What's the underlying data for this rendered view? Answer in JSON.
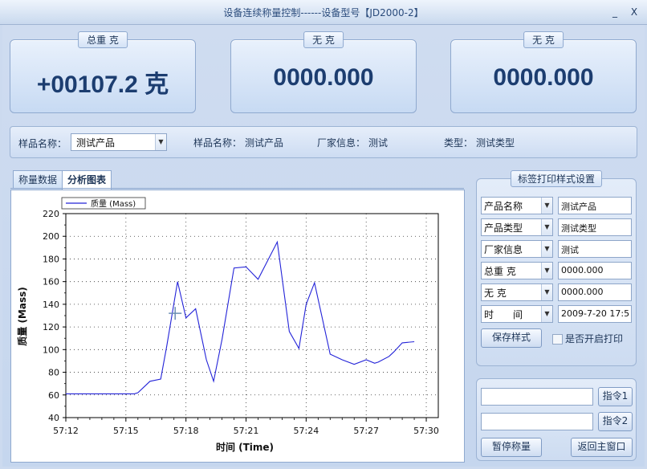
{
  "window": {
    "title": "设备连续称量控制------设备型号【JD2000-2】",
    "minimize_glyph": "_",
    "close_glyph": "X"
  },
  "displays": [
    {
      "label": "总重 克",
      "value": "+00107.2 克"
    },
    {
      "label": "无 克",
      "value": "0000.000"
    },
    {
      "label": "无 克",
      "value": "0000.000"
    }
  ],
  "info_bar": {
    "sample_label": "样品名称：",
    "sample_select": "测试产品",
    "sample_name_label": "样品名称：",
    "sample_name_value": "测试产品",
    "maker_label": "厂家信息：",
    "maker_value": "测试",
    "type_label": "类型：",
    "type_value": "测试类型"
  },
  "tabs": [
    {
      "label": "称量数据",
      "active": false
    },
    {
      "label": "分析图表",
      "active": true
    }
  ],
  "label_settings": {
    "title": "标签打印样式设置",
    "rows": [
      {
        "field": "产品名称",
        "value": "测试产品"
      },
      {
        "field": "产品类型",
        "value": "测试类型"
      },
      {
        "field": "厂家信息",
        "value": "测试"
      },
      {
        "field": "总重 克",
        "value": "0000.000"
      },
      {
        "field": "无 克",
        "value": "0000.000"
      },
      {
        "field": "时　　间",
        "value": "2009-7-20 17:5"
      }
    ],
    "save_button": "保存样式",
    "auto_print_label": "是否开启打印",
    "auto_print_checked": false
  },
  "commands": {
    "cmd1_value": "",
    "cmd1_button": "指令1",
    "cmd2_value": "",
    "cmd2_button": "指令2",
    "pause_button": "暂停称量",
    "back_button": "返回主窗口"
  },
  "chart_data": {
    "type": "line",
    "legend": "质量 (Mass)",
    "series": [
      {
        "name": "质量 (Mass)",
        "color": "#2323d8",
        "x": [
          0,
          1,
          2,
          3,
          4,
          5,
          5.7,
          6,
          7,
          7.9,
          8.4,
          9.3,
          10,
          10.8,
          11.7,
          12.3,
          13,
          14,
          15,
          16,
          17.6,
          18.6,
          19.4,
          20,
          20.7,
          22,
          23,
          24,
          25,
          25.7,
          26,
          26.9,
          27.3,
          28,
          29
        ],
        "y": [
          61,
          61,
          61,
          61,
          61,
          61,
          61,
          62,
          72,
          74,
          103,
          160,
          128,
          136,
          91,
          72,
          109,
          172,
          173,
          162,
          195,
          116,
          101,
          140,
          159,
          96,
          91,
          87,
          91,
          88,
          89,
          94,
          98,
          106,
          107
        ]
      }
    ],
    "x_ticks": [
      "57:12",
      "57:15",
      "57:18",
      "57:21",
      "57:24",
      "57:27",
      "57:30"
    ],
    "y_ticks": [
      40,
      60,
      80,
      100,
      120,
      140,
      160,
      180,
      200,
      220
    ],
    "xlabel": "时间 (Time)",
    "ylabel": "质量 (Mass)",
    "xlim": [
      0,
      31
    ],
    "ylim": [
      40,
      220
    ],
    "grid": true,
    "cursor": {
      "x": 9.1,
      "y": 132
    }
  }
}
